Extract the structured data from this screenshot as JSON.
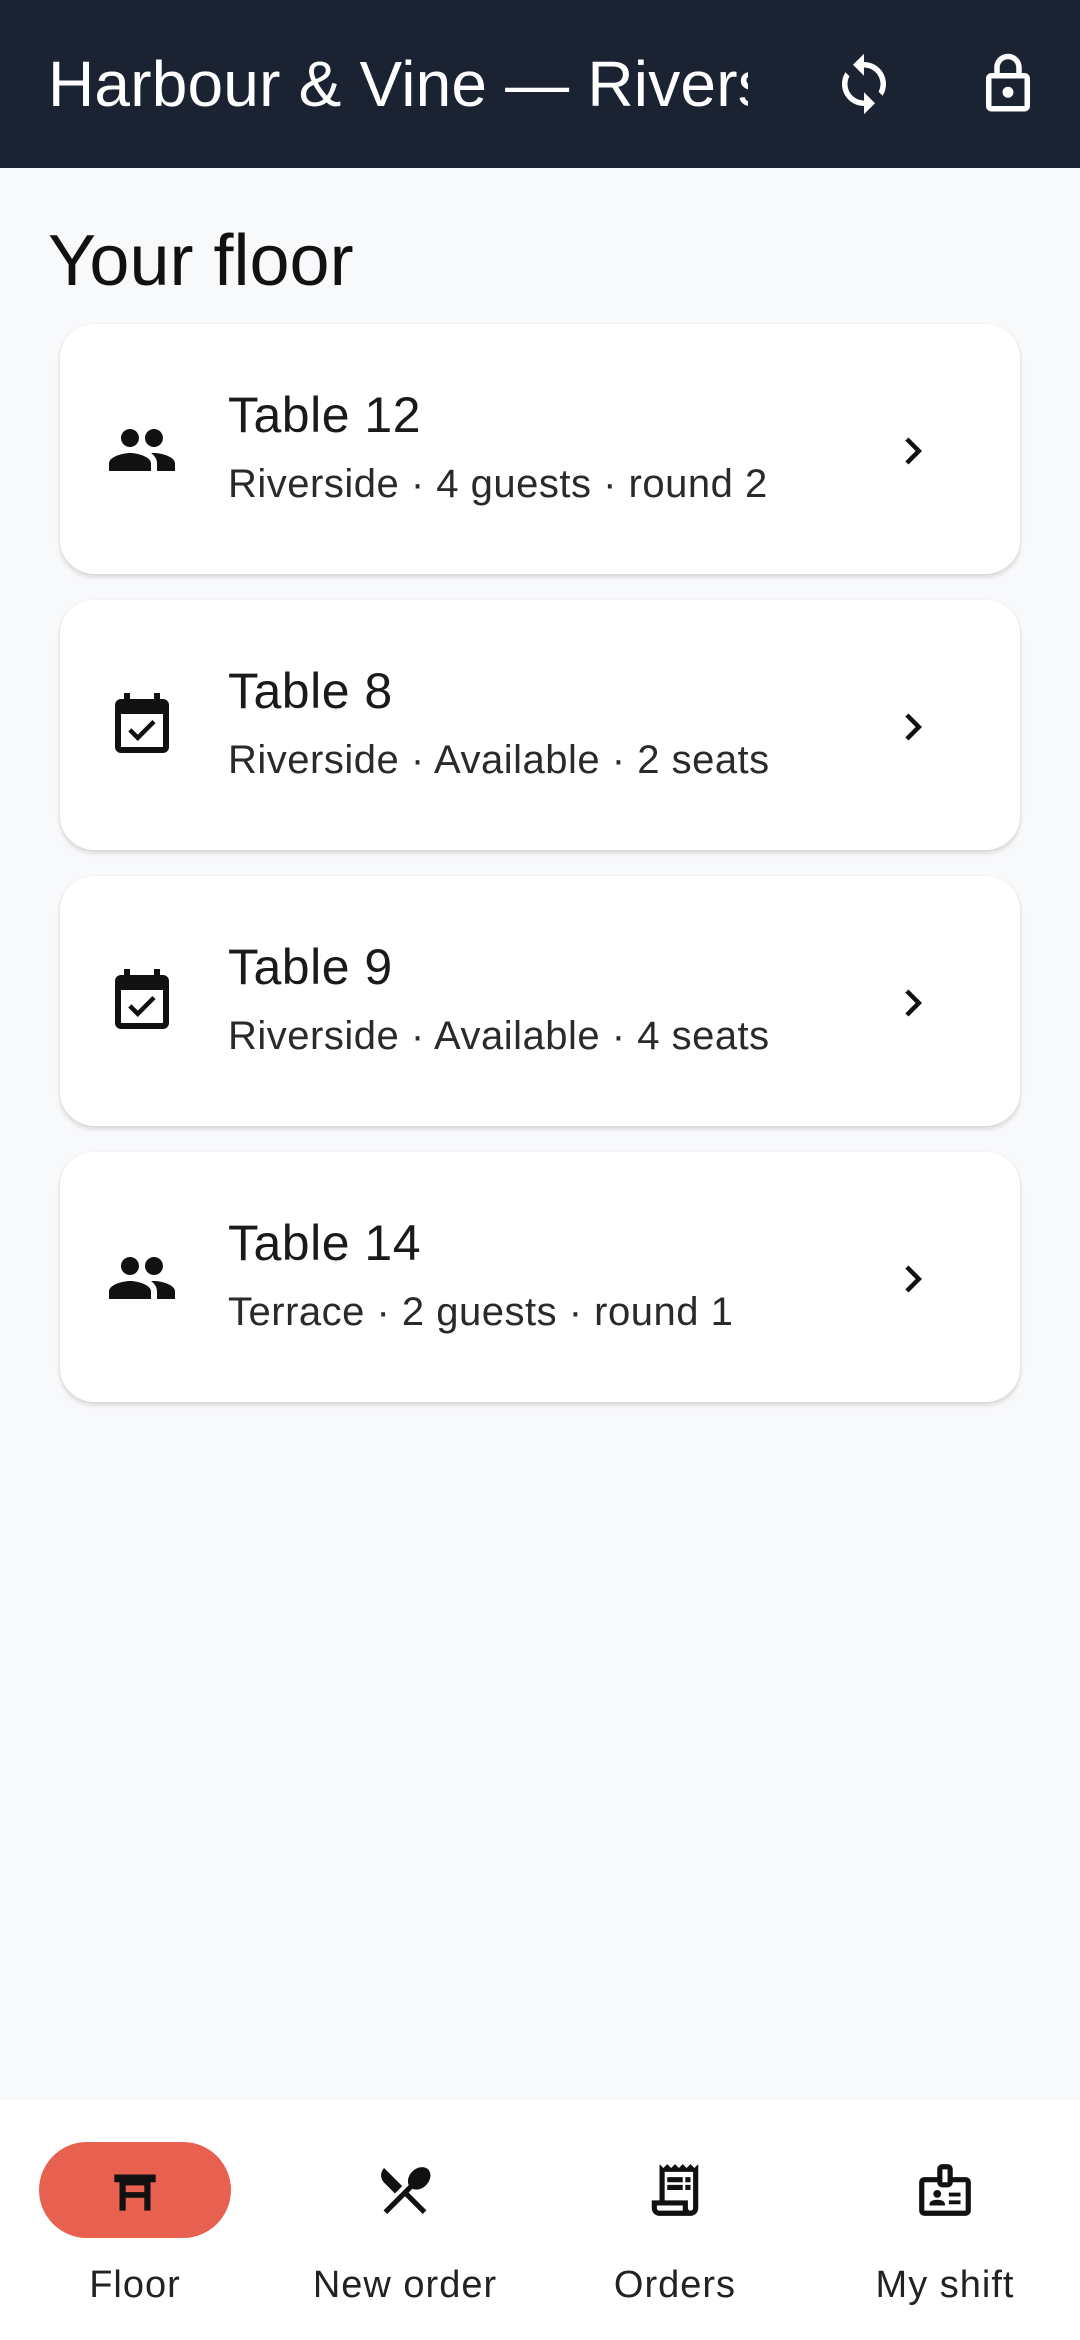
{
  "app_bar": {
    "title": "Harbour & Vine — Riverside",
    "sync_icon": "sync-icon",
    "lock_icon": "lock-icon"
  },
  "main": {
    "section_title": "Your floor",
    "tables": [
      {
        "icon": "people-icon",
        "title": "Table 12",
        "subtitle": "Riverside · 4 guests · round 2"
      },
      {
        "icon": "calendar-check-icon",
        "title": "Table 8",
        "subtitle": "Riverside · Available · 2 seats"
      },
      {
        "icon": "calendar-check-icon",
        "title": "Table 9",
        "subtitle": "Riverside · Available · 4 seats"
      },
      {
        "icon": "people-icon",
        "title": "Table 14",
        "subtitle": "Terrace · 2 guests · round 1"
      }
    ]
  },
  "bottom_nav": {
    "items": [
      {
        "label": "Floor",
        "icon": "table-icon",
        "active": true
      },
      {
        "label": "New order",
        "icon": "utensils-icon",
        "active": false
      },
      {
        "label": "Orders",
        "icon": "receipt-icon",
        "active": false
      },
      {
        "label": "My shift",
        "icon": "badge-icon",
        "active": false
      }
    ]
  },
  "colors": {
    "app_bar_bg": "#1b2333",
    "page_bg": "#f8f9fb",
    "active_nav_pill": "#e8604f"
  }
}
